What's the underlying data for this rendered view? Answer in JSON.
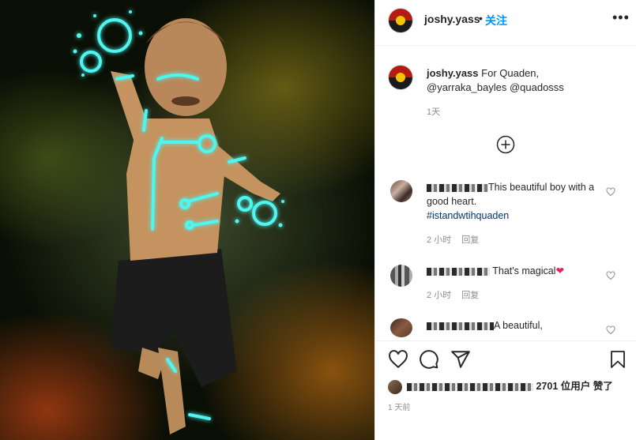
{
  "post": {
    "username": "joshy.yass",
    "separator": "•",
    "follow_label": "关注",
    "more_label": "•••"
  },
  "caption": {
    "username": "joshy.yass",
    "text": " For Quaden,",
    "mentions": "@yarraka_bayles @quadosss",
    "time": "1天"
  },
  "comments": [
    {
      "text": "This beautiful boy with a good heart.",
      "hashtag": "#istandwtihquaden",
      "time": "2 小时",
      "reply": "回复"
    },
    {
      "text": "That's magical",
      "emoji": "❤",
      "time": "2 小时",
      "reply": "回复"
    },
    {
      "text": "A beautiful,"
    }
  ],
  "likes": {
    "partial": "2701",
    "suffix": "位用户 赞了"
  },
  "post_time": "1 天前",
  "icons": {
    "like": "heart-icon",
    "comment": "comment-icon",
    "share": "share-icon",
    "save": "bookmark-icon",
    "load_more": "plus-circle-icon"
  },
  "colors": {
    "follow": "#0095f6",
    "hashtag": "#00376b",
    "glow": "#4ff5ef"
  }
}
